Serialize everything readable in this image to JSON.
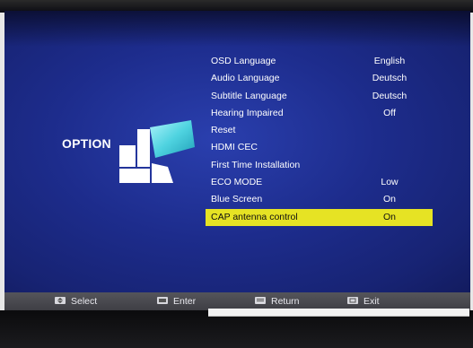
{
  "option_title": "OPTION",
  "menu": [
    {
      "label": "OSD Language",
      "value": "English"
    },
    {
      "label": "Audio Language",
      "value": "Deutsch"
    },
    {
      "label": "Subtitle Language",
      "value": "Deutsch"
    },
    {
      "label": "Hearing Impaired",
      "value": "Off"
    },
    {
      "label": "Reset",
      "value": ""
    },
    {
      "label": "HDMI CEC",
      "value": ""
    },
    {
      "label": "First Time Installation",
      "value": ""
    },
    {
      "label": "ECO MODE",
      "value": "Low"
    },
    {
      "label": "Blue Screen",
      "value": "On"
    },
    {
      "label": "CAP antenna control",
      "value": "On",
      "selected": true
    }
  ],
  "footer": {
    "select": {
      "label": "Select",
      "icon": "up-down-key-icon"
    },
    "enter": {
      "label": "Enter",
      "icon": "ok-key-icon"
    },
    "return": {
      "label": "Return",
      "icon": "menu-key-icon"
    },
    "exit": {
      "label": "Exit",
      "icon": "exit-key-icon"
    }
  },
  "colors": {
    "screen_blue": "#1d2c8c",
    "highlight_yellow": "#e6e324",
    "footer_gray": "#4a4a50",
    "icon_cyan": "#4fd3e0"
  }
}
